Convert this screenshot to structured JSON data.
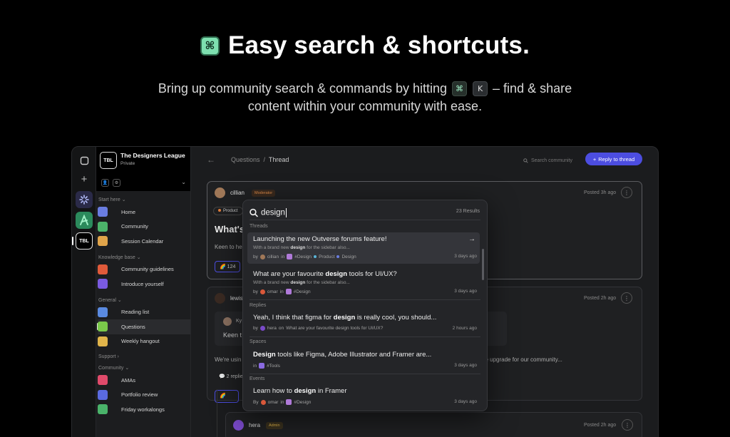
{
  "hero": {
    "icon": "command-icon",
    "title": "Easy search & shortcuts.",
    "subtitle_part1": "Bring up community search & commands by hitting",
    "key1": "⌘",
    "key2": "K",
    "subtitle_part2": "– find & share",
    "subtitle_line2": "content within your community with ease."
  },
  "rail": {
    "communities": [
      "TBL"
    ]
  },
  "community": {
    "logo": "TBL",
    "name": "The Designers League",
    "visibility": "Private"
  },
  "sidebar": {
    "sections": [
      {
        "title": "Start here",
        "items": [
          {
            "label": "Home",
            "color": "#6a7de0"
          },
          {
            "label": "Community",
            "color": "#4cb36a"
          },
          {
            "label": "Session Calendar",
            "color": "#e0a44a"
          }
        ]
      },
      {
        "title": "Knowledge base",
        "items": [
          {
            "label": "Community guidelines",
            "color": "#e05a3a"
          },
          {
            "label": "Introduce yourself",
            "color": "#7a5ae0"
          }
        ]
      },
      {
        "title": "General",
        "items": [
          {
            "label": "Reading list",
            "color": "#5a8ae0"
          },
          {
            "label": "Questions",
            "color": "#7ac94a"
          },
          {
            "label": "Weekly hangout",
            "color": "#e0b44a"
          }
        ]
      },
      {
        "title": "Support",
        "items": []
      },
      {
        "title": "Community",
        "items": [
          {
            "label": "AMAs",
            "color": "#e04a6a"
          },
          {
            "label": "Portfolio review",
            "color": "#5a6ae0"
          },
          {
            "label": "Friday workalongs",
            "color": "#4ab36a"
          }
        ]
      }
    ]
  },
  "topbar": {
    "breadcrumb_parent": "Questions",
    "breadcrumb_sep": "/",
    "breadcrumb_current": "Thread",
    "search_placeholder": "Search community",
    "reply_button": "Reply to thread"
  },
  "thread": {
    "post1": {
      "author": "cillian",
      "role": "Moderator",
      "posted": "Posted 3h ago",
      "tag": "Product",
      "title": "What's",
      "text": "Keen to he",
      "reactions": "124"
    },
    "post2": {
      "author": "lewis",
      "posted": "Posted 2h ago",
      "quote_author": "Ky",
      "quote_text": "Keen t",
      "text_left": "We're usin",
      "text_right": "ge upgrade for our community...",
      "replies": "2 replie"
    },
    "post3": {
      "author": "hera",
      "role": "Admin",
      "posted": "Posted 2h ago"
    }
  },
  "palette": {
    "query": "design",
    "count": "23 Results",
    "sections": {
      "threads": "Threads",
      "replies": "Replies",
      "spaces": "Spaces",
      "events": "Events"
    },
    "results": [
      {
        "title_pre": "Launching the new Outverse forums feature!",
        "snip_pre": "With a brand new ",
        "snip_bold": "design",
        "snip_post": " for the sidebar also...",
        "by": "by",
        "author": "cillian",
        "in": "in",
        "space": "#Design",
        "tag1": "Product",
        "tag2": "Design",
        "time": "3 days ago"
      },
      {
        "title_pre": "What are your favourite ",
        "title_bold": "design",
        "title_post": " tools for UI/UX?",
        "snip_pre": "With a brand new ",
        "snip_bold": "design",
        "snip_post": " for the sidebar also...",
        "by": "by",
        "author": "omar",
        "in": "in",
        "space": "#Design",
        "time": "3 days ago"
      },
      {
        "title_pre": "Yeah, I think that figma for ",
        "title_bold": "design",
        "title_post": " is really cool, you should...",
        "by": "by",
        "author": "hera",
        "on": "on",
        "context": "What are your favourite design tools for UI/UX?",
        "time": "2 hours ago"
      },
      {
        "title_bold": "Design",
        "title_post": " tools like Figma, Adobe Illustrator and Framer are...",
        "in": "in",
        "space": "#Tools",
        "time": "3 days ago"
      },
      {
        "title_pre": "Learn how to ",
        "title_bold": "design",
        "title_post": " in Framer",
        "by": "By",
        "author": "omar",
        "in": "in",
        "space": "#Design",
        "time": "3 days ago"
      }
    ]
  }
}
